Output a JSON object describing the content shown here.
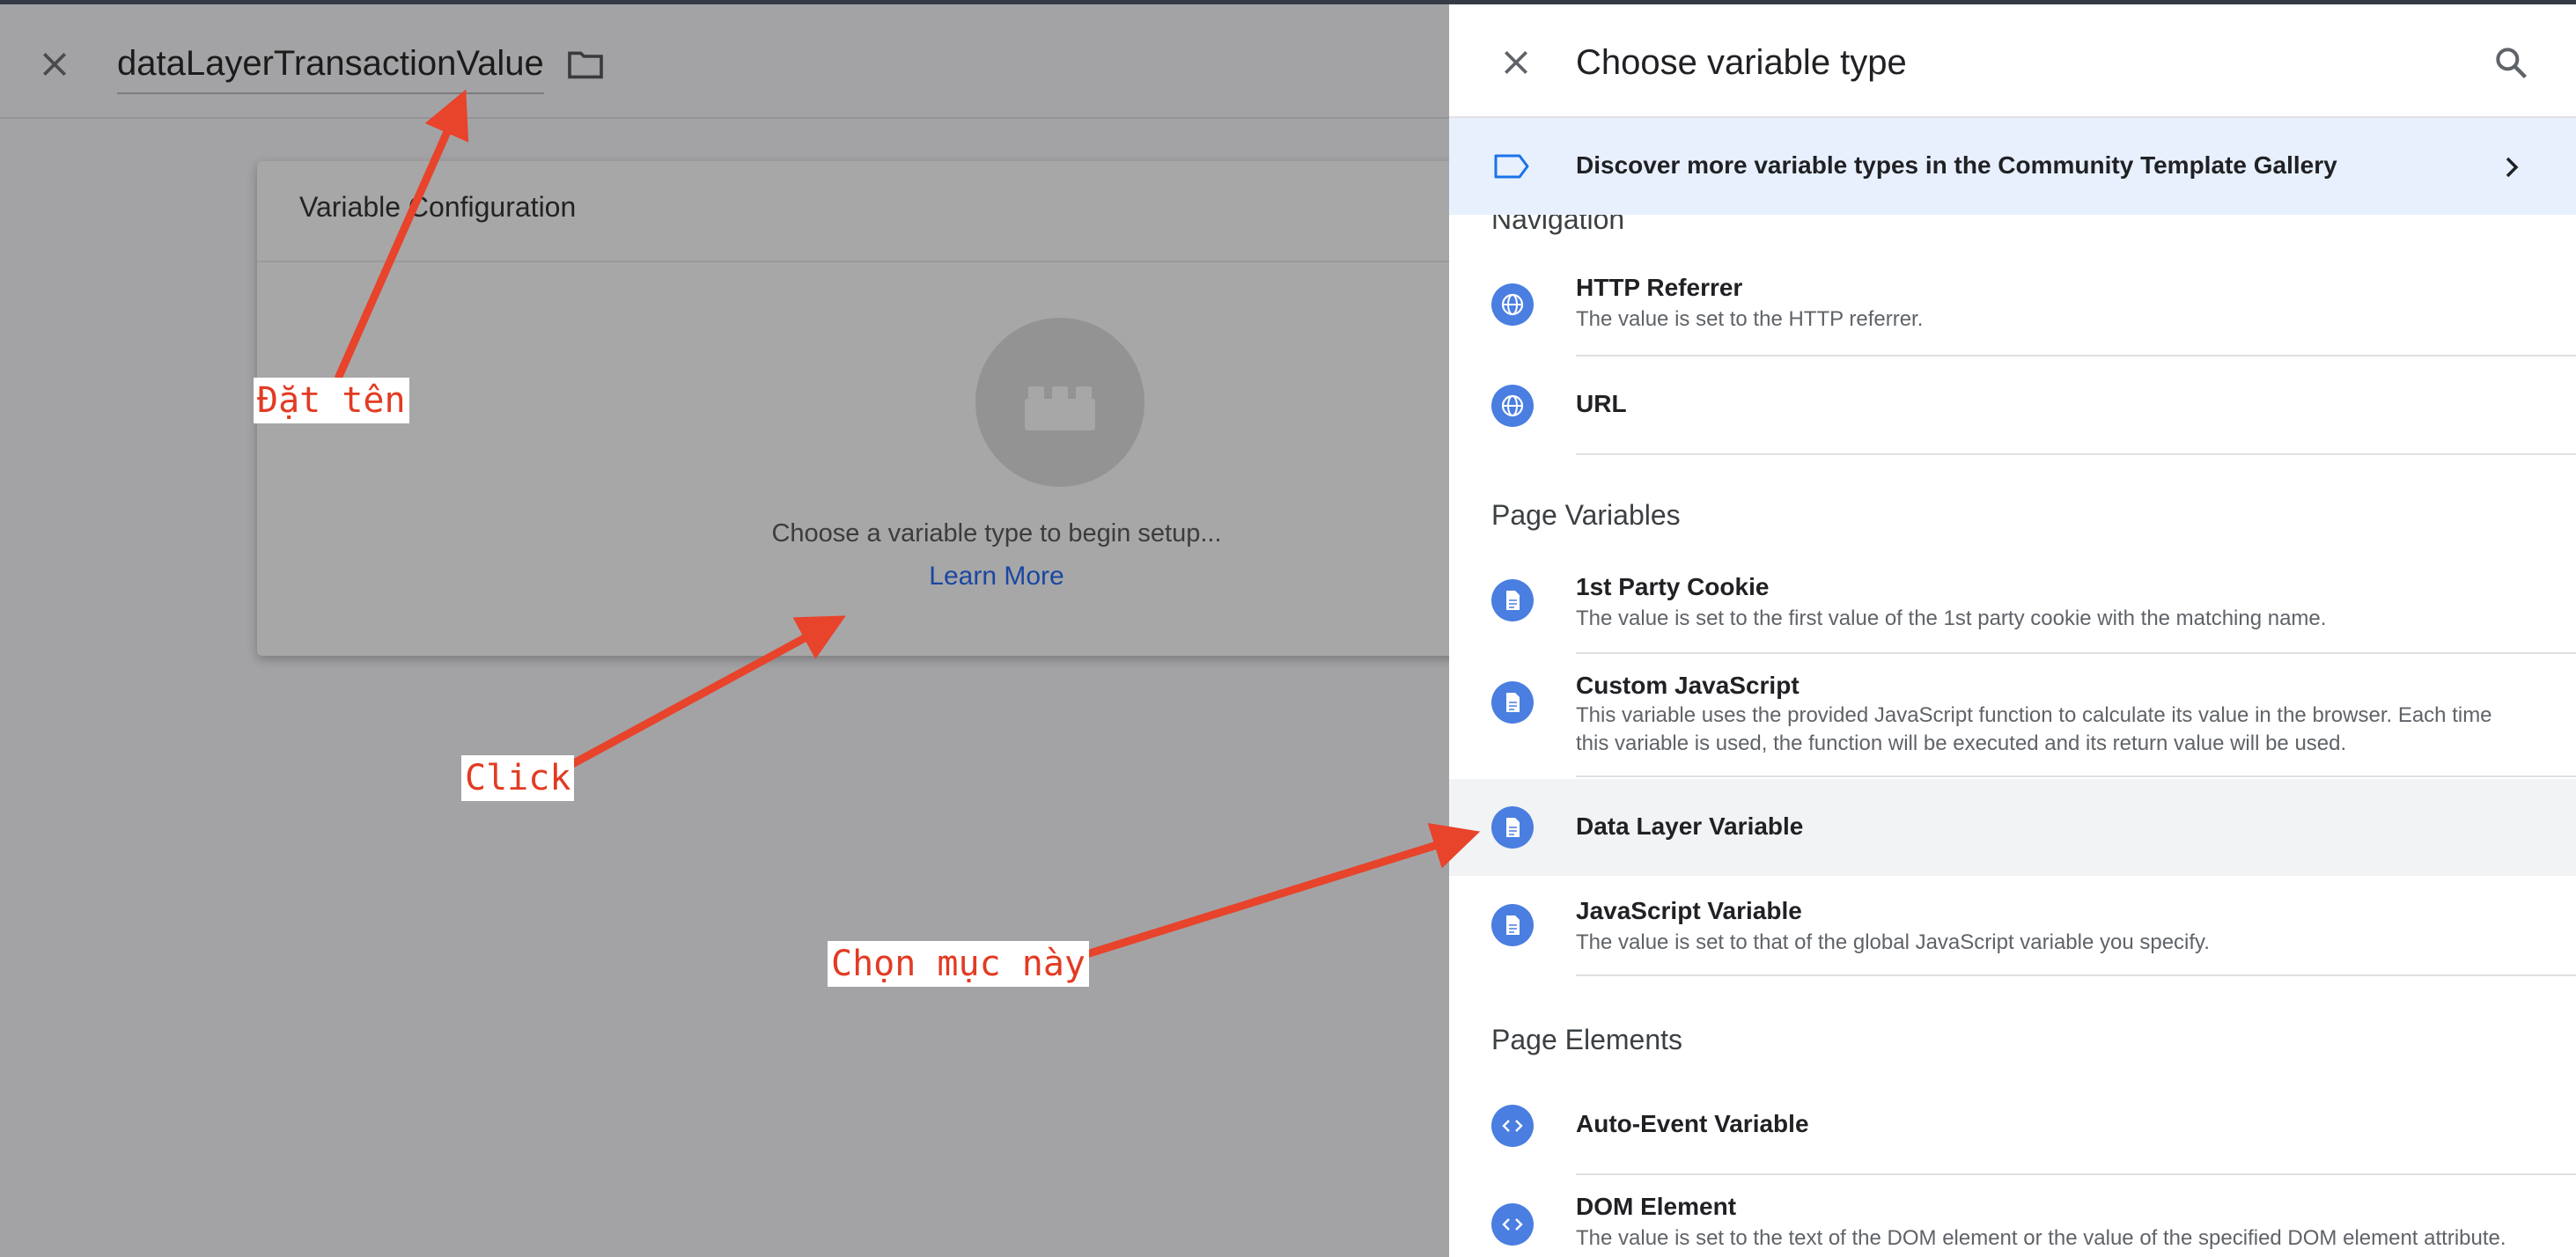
{
  "editor": {
    "variable_name": "dataLayerTransactionValue",
    "close_icon": "close-icon",
    "folder_icon": "folder-icon"
  },
  "config_card": {
    "title": "Variable Configuration",
    "prompt": "Choose a variable type to begin setup...",
    "learn_more": "Learn More",
    "icon": "bricks-icon"
  },
  "panel": {
    "title": "Choose variable type",
    "search_icon": "search-icon",
    "banner": {
      "text": "Discover more variable types in the Community Template Gallery",
      "icon": "tag-icon"
    },
    "sections": [
      {
        "title": "Navigation"
      },
      {
        "title": "Page Variables"
      },
      {
        "title": "Page Elements"
      }
    ],
    "items": [
      {
        "name": "HTTP Referrer",
        "desc": "The value is set to the HTTP referrer.",
        "icon": "globe-icon"
      },
      {
        "name": "URL",
        "desc": "",
        "icon": "globe-icon"
      },
      {
        "name": "1st Party Cookie",
        "desc": "The value is set to the first value of the 1st party cookie with the matching name.",
        "icon": "document-icon"
      },
      {
        "name": "Custom JavaScript",
        "desc": "This variable uses the provided JavaScript function to calculate its value in the browser. Each time this variable is used, the function will be executed and its return value will be used.",
        "icon": "document-icon"
      },
      {
        "name": "Data Layer Variable",
        "desc": "",
        "icon": "document-icon"
      },
      {
        "name": "JavaScript Variable",
        "desc": "The value is set to that of the global JavaScript variable you specify.",
        "icon": "document-icon"
      },
      {
        "name": "Auto-Event Variable",
        "desc": "",
        "icon": "code-icon"
      },
      {
        "name": "DOM Element",
        "desc": "The value is set to the text of the DOM element or the value of the specified DOM element attribute.",
        "icon": "code-icon"
      }
    ]
  },
  "annotations": {
    "name_it": "Đặt tên",
    "click": "Click",
    "choose_this": "Chọn mục này"
  },
  "colors": {
    "accent_blue": "#4a7ee0",
    "annotation_red": "#e23b23",
    "banner_bg": "#e8f0fe"
  }
}
